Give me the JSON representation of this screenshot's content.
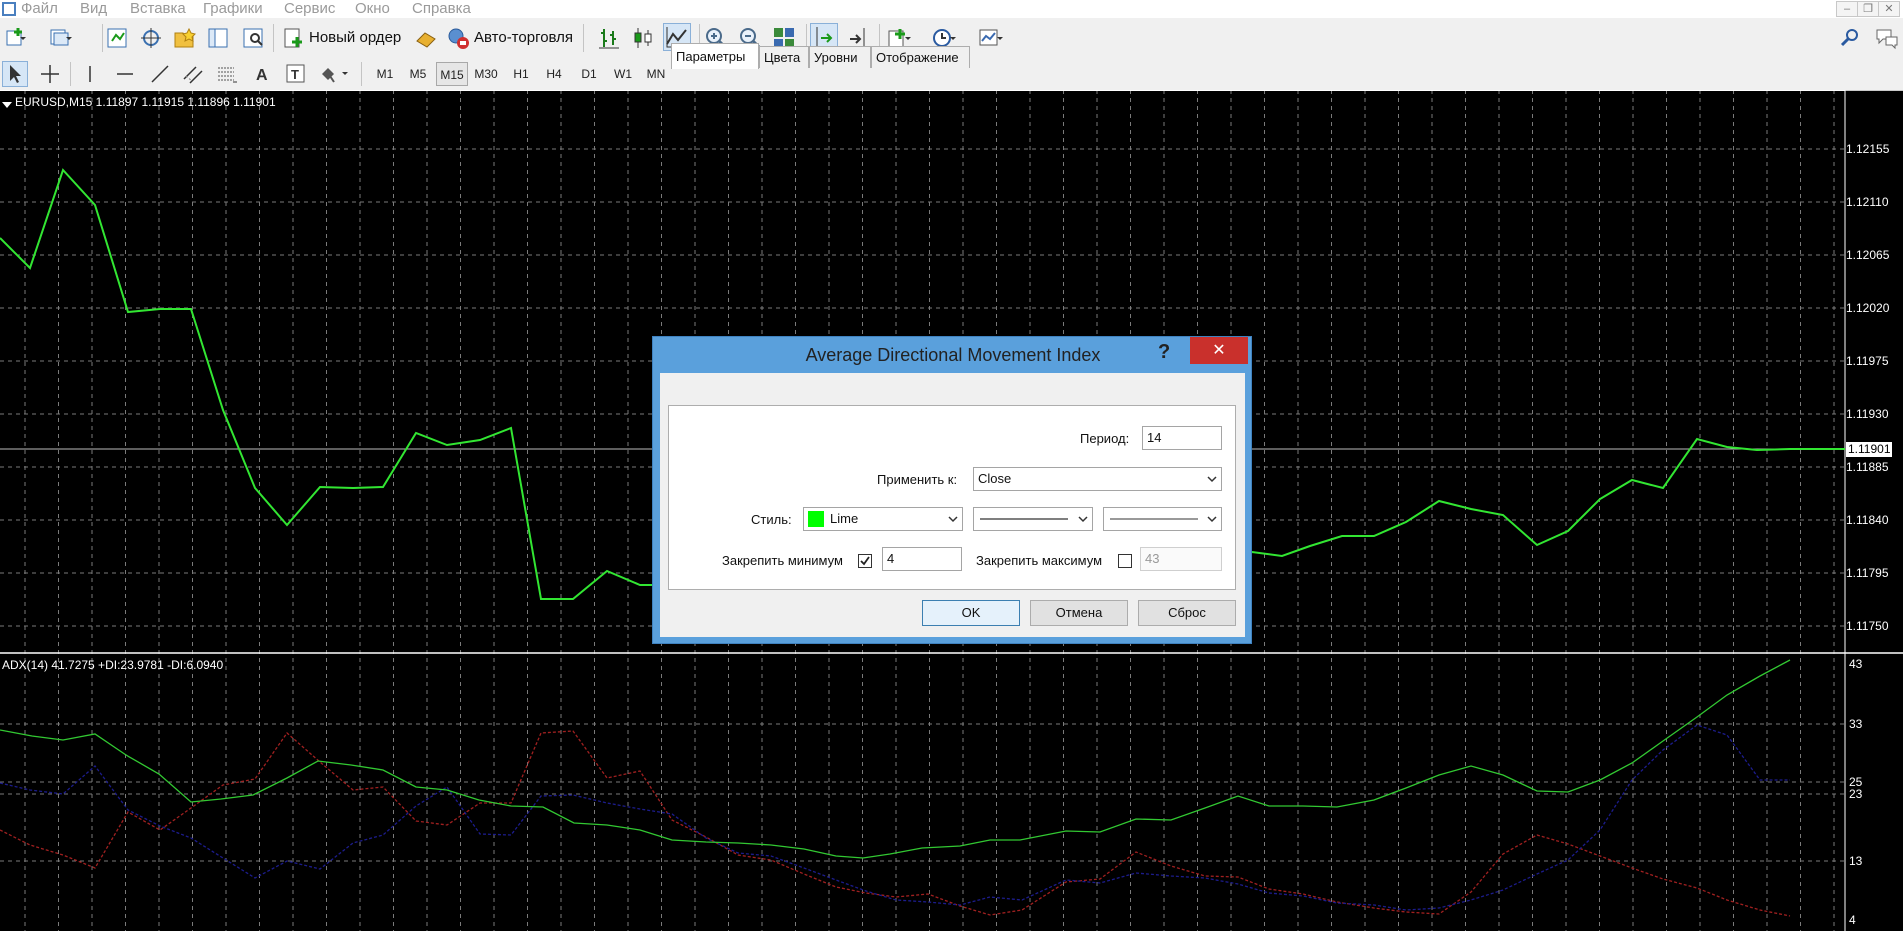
{
  "menu": {
    "items": [
      "Файл",
      "Вид",
      "Вставка",
      "Графики",
      "Сервис",
      "Окно",
      "Справка"
    ],
    "window_buttons": [
      "‒",
      "❐",
      "✕"
    ]
  },
  "toolbar": {
    "new_order_label": "Новый ордер",
    "autotrading_label": "Авто-торговля",
    "timeframes": [
      "M1",
      "M5",
      "M15",
      "M30",
      "H1",
      "H4",
      "D1",
      "W1",
      "MN"
    ],
    "active_timeframe": "M15"
  },
  "chart": {
    "symbol_info": "EURUSD,M15  1.11897 1.11915 1.11896 1.11901",
    "price_ticks": [
      "1.12155",
      "1.12110",
      "1.12065",
      "1.12020",
      "1.11975",
      "1.11930",
      "1.11885",
      "1.11840",
      "1.11795",
      "1.11750"
    ],
    "current_price": "1.11901",
    "line_color": "#32e632",
    "indicator_info": "ADX(14) 41.7275 +DI:23.9781 -DI:6.0940",
    "indicator_ticks": [
      "43",
      "33",
      "25",
      "23",
      "13",
      "4"
    ],
    "adx_color": "#32c832",
    "plus_di_color": "#1c1c8c",
    "minus_di_color": "#a02020"
  },
  "dialog": {
    "title": "Average Directional Movement Index",
    "help_glyph": "?",
    "close_glyph": "✕",
    "tabs": [
      "Параметры",
      "Цвета",
      "Уровни",
      "Отображение"
    ],
    "active_tab": "Параметры",
    "period_label": "Период:",
    "period_value": "14",
    "apply_label": "Применить к:",
    "apply_value": "Close",
    "style_label": "Стиль:",
    "style_color_name": "Lime",
    "style_color": "#00ff00",
    "fix_min_label": "Закрепить минимум",
    "fix_min_checked": true,
    "fix_min_value": "4",
    "fix_max_label": "Закрепить максимум",
    "fix_max_checked": false,
    "fix_max_value": "43",
    "ok_label": "OK",
    "cancel_label": "Отмена",
    "reset_label": "Сброс"
  }
}
